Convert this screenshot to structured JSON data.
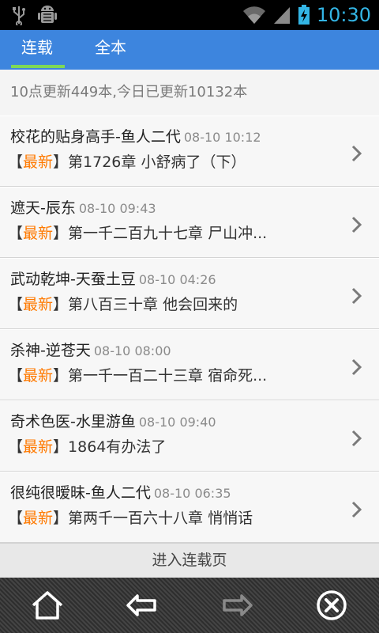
{
  "status_bar": {
    "clock": "10:30"
  },
  "tabs": [
    {
      "label": "连载",
      "active": true
    },
    {
      "label": "全本",
      "active": false
    }
  ],
  "summary": "10点更新449本,今日已更新10132本",
  "new_tag": "最新",
  "bracket_open": "【",
  "bracket_close": "】",
  "items": [
    {
      "title": "校花的贴身高手-鱼人二代",
      "time": "08-10 10:12",
      "chapter": "第1726章 小舒病了（下）"
    },
    {
      "title": "遮天-辰东",
      "time": "08-10 09:43",
      "chapter": "第一千二百九十七章 尸山冲..."
    },
    {
      "title": "武动乾坤-天蚕土豆",
      "time": "08-10 04:26",
      "chapter": "第八百三十章 他会回来的"
    },
    {
      "title": "杀神-逆苍天",
      "time": "08-10 08:00",
      "chapter": "第一千一百二十三章 宿命死..."
    },
    {
      "title": "奇术色医-水里游鱼",
      "time": "08-10 09:40",
      "chapter": "1864有办法了"
    },
    {
      "title": "很纯很暧昧-鱼人二代",
      "time": "08-10 06:35",
      "chapter": "第两千一百六十八章 悄悄话"
    }
  ],
  "enter_link": "进入连载页",
  "colors": {
    "accent": "#3d85de",
    "new_tag": "#ff7a00",
    "tab_indicator": "#7ed957",
    "status_icons": "#33b5e5"
  }
}
